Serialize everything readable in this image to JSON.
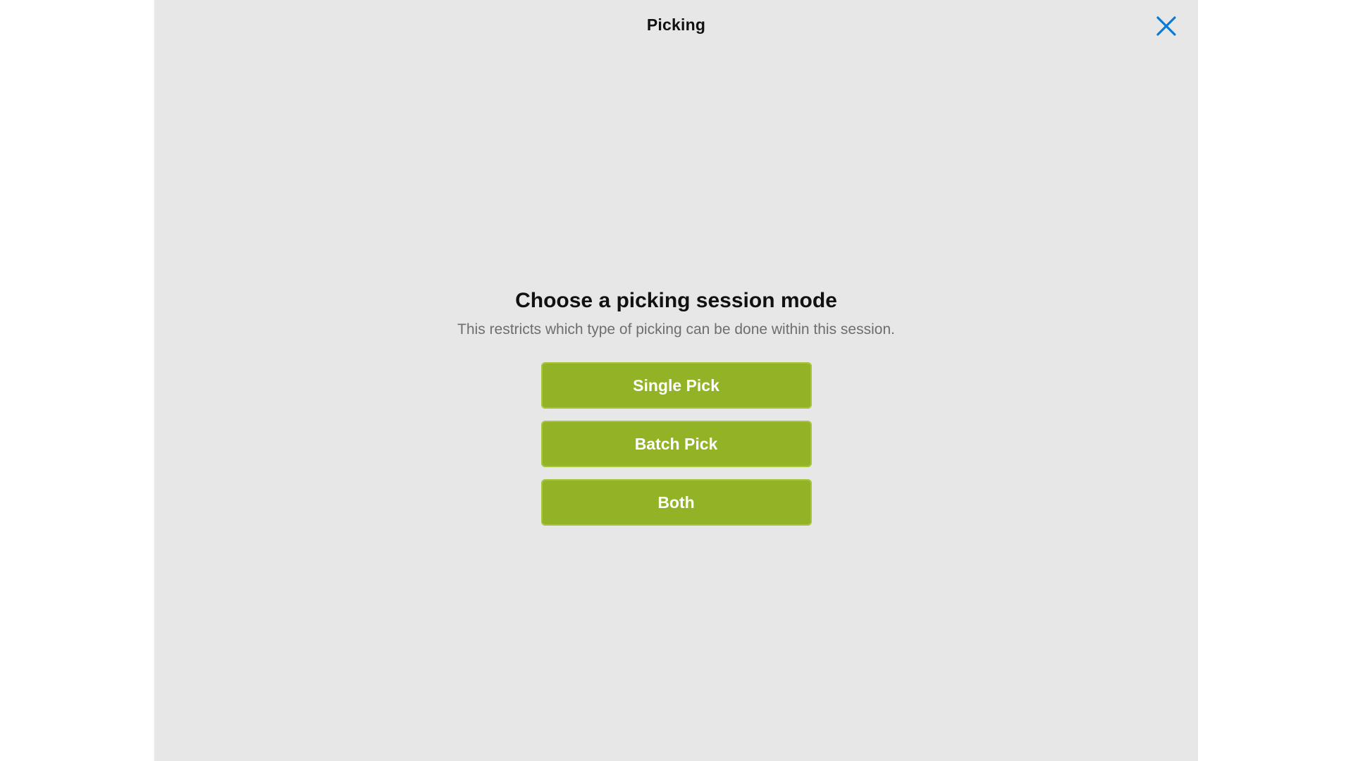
{
  "header": {
    "title": "Picking",
    "close_icon": "close-icon"
  },
  "main": {
    "title": "Choose a picking session mode",
    "subtitle": "This restricts which type of picking can be done within this session.",
    "buttons": [
      {
        "label": "Single Pick"
      },
      {
        "label": "Batch Pick"
      },
      {
        "label": "Both"
      }
    ]
  },
  "colors": {
    "accent_blue": "#0a7ad4",
    "button_green": "#92b325",
    "modal_background": "#e7e7e8"
  }
}
